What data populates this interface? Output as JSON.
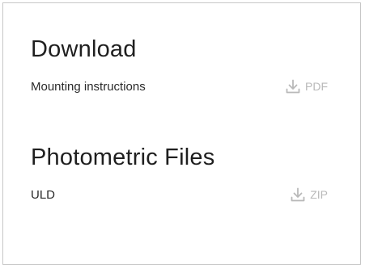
{
  "download_section": {
    "title": "Download",
    "items": [
      {
        "label": "Mounting instructions",
        "link_label": "PDF",
        "icon": "download-icon"
      }
    ]
  },
  "photometric_section": {
    "title": "Photometric Files",
    "items": [
      {
        "label": "ULD",
        "link_label": "ZIP",
        "icon": "download-icon"
      }
    ]
  },
  "colors": {
    "text": "#222222",
    "link": "#b9b9b9",
    "border": "#c7c7c7",
    "background": "#ffffff"
  }
}
